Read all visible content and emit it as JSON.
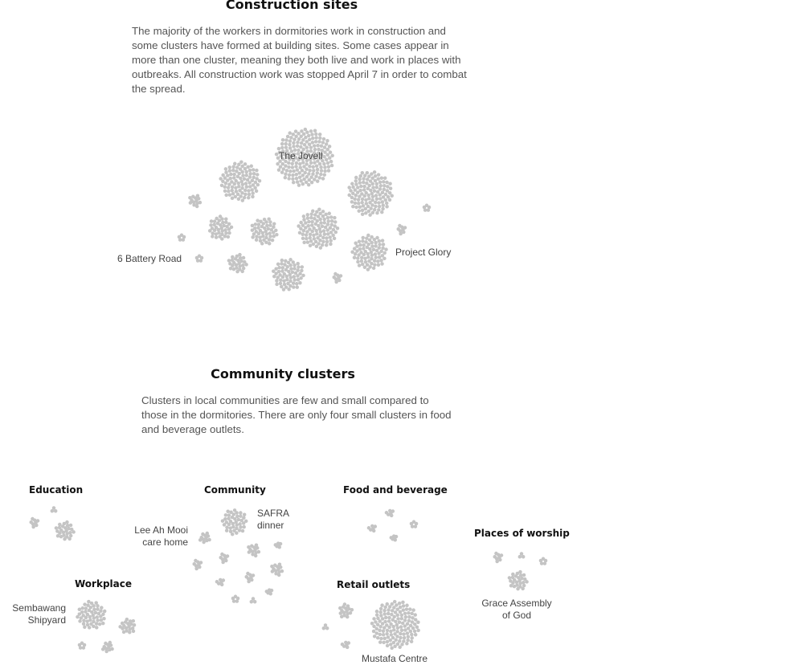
{
  "construction": {
    "title": "Construction sites",
    "description": "The majority of the workers in dormitories work in construction and some clusters have formed at building sites. Some cases appear in more than one cluster, meaning they both live and work in places with outbreaks. All construction work was stopped April 7 in order to combat the spread.",
    "labels": {
      "jovell": "The Jovell",
      "battery": "6 Battery Road",
      "glory": "Project Glory"
    }
  },
  "community": {
    "title": "Community clusters",
    "description": "Clusters in local communities are few and small compared to those in the dormitories. There are only four small clusters in food and beverage outlets.",
    "categories": {
      "education": "Education",
      "community": "Community",
      "food": "Food and beverage",
      "worship": "Places of worship",
      "workplace": "Workplace",
      "retail": "Retail outlets"
    },
    "labels": {
      "safra_line1": "SAFRA",
      "safra_line2": "dinner",
      "leeahmooi_line1": "Lee Ah Mooi",
      "leeahmooi_line2": "care home",
      "grace_line1": "Grace Assembly",
      "grace_line2": "of God",
      "sembawang_line1": "Sembawang",
      "sembawang_line2": "Shipyard",
      "mustafa": "Mustafa Centre"
    }
  },
  "colors": {
    "dot": "#c4c4c4",
    "text": "#555555",
    "title": "#111111"
  }
}
